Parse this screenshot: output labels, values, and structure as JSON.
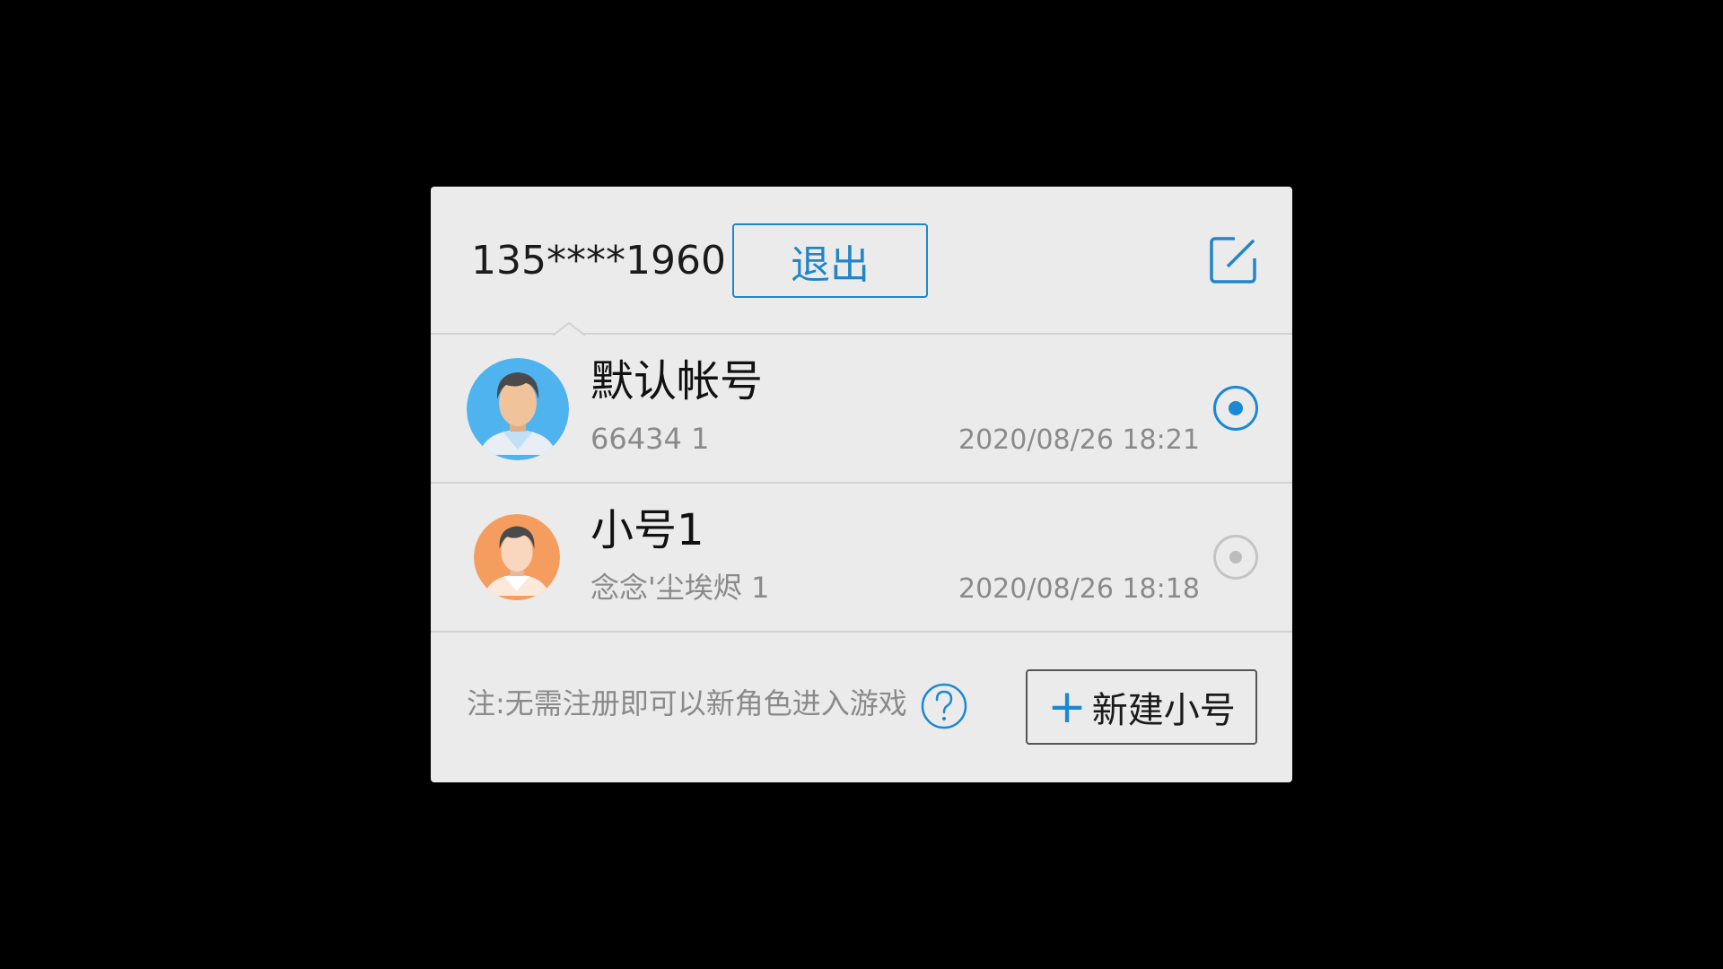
{
  "header": {
    "account_phone": "135****1960",
    "logout_label": "退出",
    "edit_icon": "edit-icon"
  },
  "accounts": [
    {
      "name": "默认帐号",
      "sub": "66434 1",
      "time": "2020/08/26 18:21",
      "selected": true,
      "avatar_color": "#4fb3ef",
      "avatar_icon": "male-avatar-icon"
    },
    {
      "name": "小号1",
      "sub": "念念'尘埃烬 1",
      "time": "2020/08/26 18:18",
      "selected": false,
      "avatar_color": "#f59d5f",
      "avatar_icon": "male-avatar-icon"
    }
  ],
  "footer": {
    "note": "注:无需注册即可以新角色进入游戏",
    "help_icon": "question-circle-icon",
    "new_label": "新建小号",
    "new_icon": "plus-icon"
  },
  "colors": {
    "accent": "#1a88d4",
    "background": "#000000",
    "dialog": "#ebebeb"
  }
}
